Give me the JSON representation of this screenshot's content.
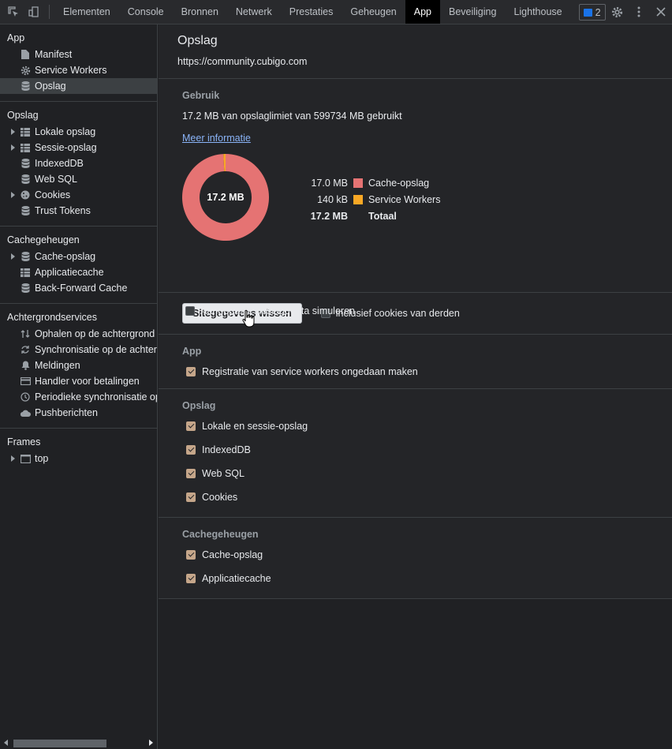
{
  "toolbar": {
    "tabs": [
      "Elementen",
      "Console",
      "Bronnen",
      "Netwerk",
      "Prestaties",
      "Geheugen",
      "App",
      "Beveiliging",
      "Lighthouse"
    ],
    "active_tab": "App",
    "issues_count": "2"
  },
  "sidebar": {
    "app_title": "App",
    "app_items": [
      "Manifest",
      "Service Workers",
      "Opslag"
    ],
    "storage_title": "Opslag",
    "storage_items": [
      "Lokale opslag",
      "Sessie-opslag",
      "IndexedDB",
      "Web SQL",
      "Cookies",
      "Trust Tokens"
    ],
    "cache_title": "Cachegeheugen",
    "cache_items": [
      "Cache-opslag",
      "Applicatiecache",
      "Back-Forward Cache"
    ],
    "bg_title": "Achtergrondservices",
    "bg_items": [
      "Ophalen op de achtergrond",
      "Synchronisatie op de achtergr",
      "Meldingen",
      "Handler voor betalingen",
      "Periodieke synchronisatie op d",
      "Pushberichten"
    ],
    "frames_title": "Frames",
    "frames_items": [
      "top"
    ]
  },
  "main": {
    "title": "Opslag",
    "origin": "https://community.cubigo.com",
    "usage_title": "Gebruik",
    "usage_text": "17.2 MB van opslaglimiet van 599734 MB gebruikt",
    "more_info": "Meer informatie",
    "donut_label": "17.2 MB",
    "legend": [
      {
        "value": "17.0 MB",
        "name": "Cache-opslag",
        "color": "#e57373"
      },
      {
        "value": "140 kB",
        "name": "Service Workers",
        "color": "#f9a825"
      }
    ],
    "total_value": "17.2 MB",
    "total_label": "Totaal",
    "quota_label": "Aangepaste opslagquota simuleren",
    "clear_button": "Sitegegevens wissen",
    "third_party_label": "inclusief cookies van derden",
    "app_group_title": "App",
    "app_group_items": [
      "Registratie van service workers ongedaan maken"
    ],
    "storage_group_title": "Opslag",
    "storage_group_items": [
      "Lokale en sessie-opslag",
      "IndexedDB",
      "Web SQL",
      "Cookies"
    ],
    "cache_group_title": "Cachegeheugen",
    "cache_group_items": [
      "Cache-opslag",
      "Applicatiecache"
    ]
  },
  "chart_data": {
    "type": "pie",
    "categories": [
      "Cache-opslag",
      "Service Workers"
    ],
    "values": [
      17.0,
      0.14
    ],
    "title": "",
    "colors": [
      "#e57373",
      "#f9a825"
    ]
  }
}
